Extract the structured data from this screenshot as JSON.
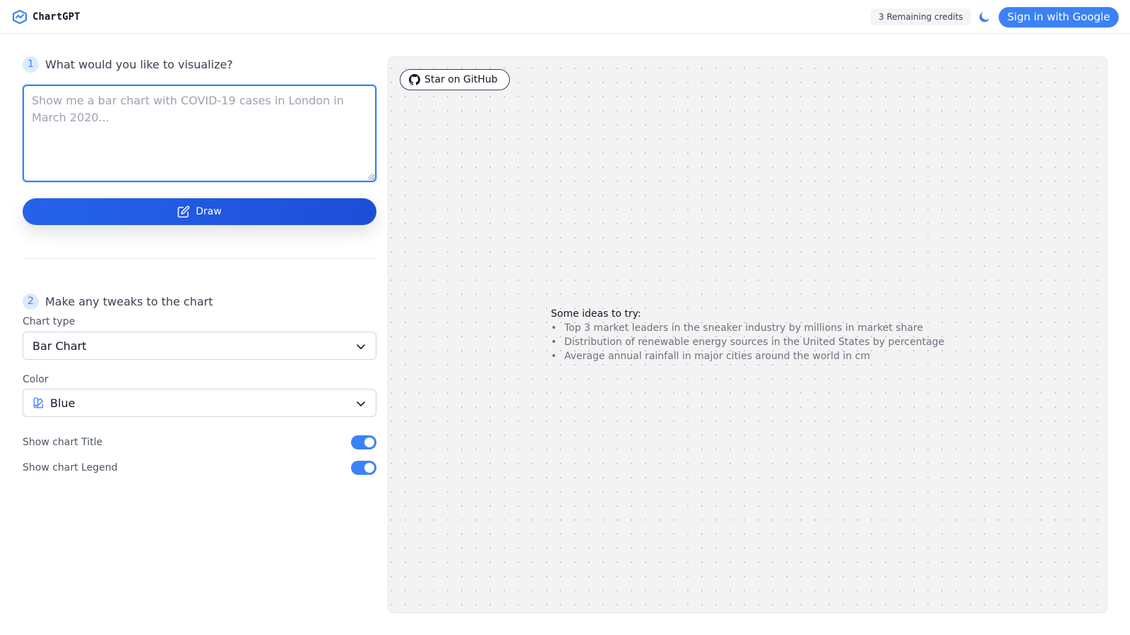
{
  "header": {
    "logo_text": "ChartGPT",
    "credits": "3 Remaining credits",
    "theme_icon": "moon-icon",
    "signin_label": "Sign in with Google"
  },
  "step1": {
    "number": "1",
    "title": "What would you like to visualize?",
    "placeholder": "Show me a bar chart with COVID-19 cases in London in March 2020...",
    "value": "",
    "draw_label": "Draw",
    "draw_icon": "edit-icon"
  },
  "step2": {
    "number": "2",
    "title": "Make any tweaks to the chart",
    "chart_type_label": "Chart type",
    "chart_type_value": "Bar Chart",
    "color_label": "Color",
    "color_value": "Blue",
    "show_title_label": "Show chart Title",
    "show_title_on": true,
    "show_legend_label": "Show chart Legend",
    "show_legend_on": true
  },
  "canvas": {
    "github_label": "Star on GitHub",
    "ideas_title": "Some ideas to try:",
    "ideas": [
      "Top 3 market leaders in the sneaker industry by millions in market share",
      "Distribution of renewable energy sources in the United States by percentage",
      "Average annual rainfall in major cities around the world in cm"
    ]
  },
  "colors": {
    "accent": "#3b82f6",
    "draw_button": "#2563eb",
    "canvas_bg": "#f3f3f3"
  }
}
